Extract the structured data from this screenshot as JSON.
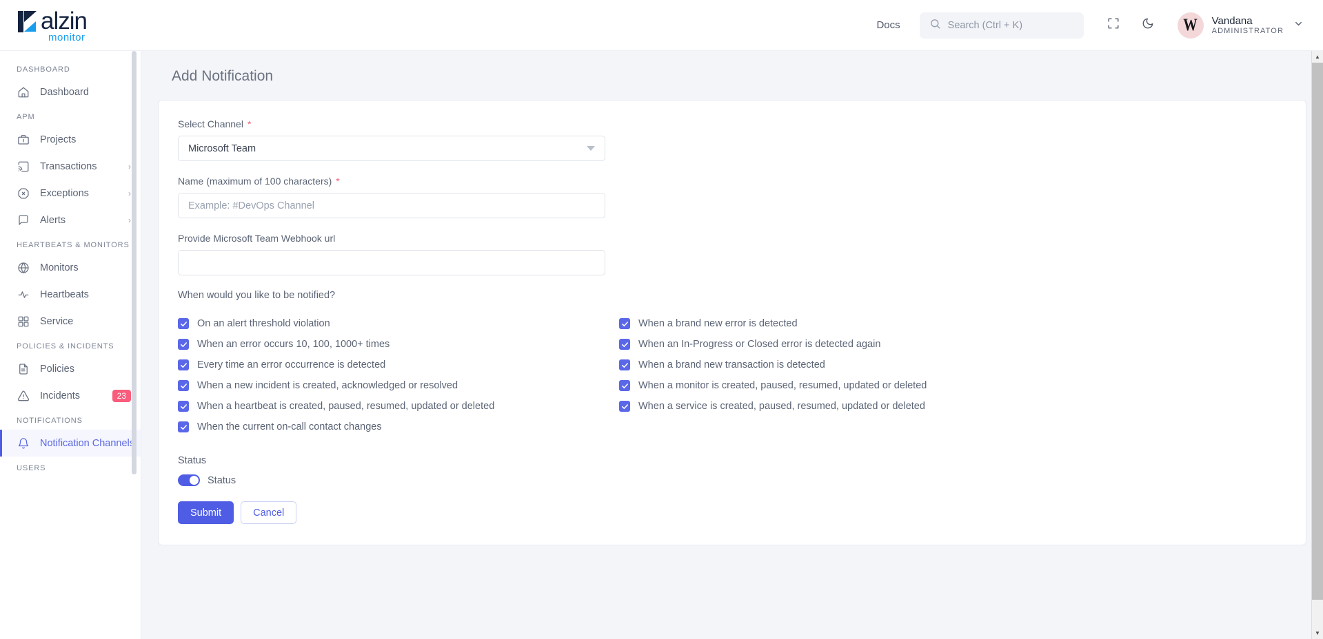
{
  "brand": {
    "name": "alzin",
    "sub": "monitor"
  },
  "header": {
    "docs_label": "Docs",
    "search_placeholder": "Search (Ctrl + K)",
    "fullscreen_icon": "fullscreen-icon",
    "theme_icon": "moon-icon",
    "profile": {
      "avatar_initial": "W",
      "name": "Vandana",
      "role": "ADMINISTRATOR"
    }
  },
  "sidebar": {
    "sections": [
      {
        "title": "DASHBOARD",
        "items": [
          {
            "label": "Dashboard",
            "icon": "home-icon",
            "chevron": false,
            "active": false,
            "badge": null
          }
        ]
      },
      {
        "title": "APM",
        "items": [
          {
            "label": "Projects",
            "icon": "briefcase-icon",
            "chevron": false,
            "active": false,
            "badge": null
          },
          {
            "label": "Transactions",
            "icon": "cast-icon",
            "chevron": true,
            "active": false,
            "badge": null
          },
          {
            "label": "Exceptions",
            "icon": "octagon-x-icon",
            "chevron": true,
            "active": false,
            "badge": null
          },
          {
            "label": "Alerts",
            "icon": "message-square-icon",
            "chevron": true,
            "active": false,
            "badge": null
          }
        ]
      },
      {
        "title": "HEARTBEATS & MONITORS",
        "items": [
          {
            "label": "Monitors",
            "icon": "globe-icon",
            "chevron": false,
            "active": false,
            "badge": null
          },
          {
            "label": "Heartbeats",
            "icon": "activity-icon",
            "chevron": false,
            "active": false,
            "badge": null
          },
          {
            "label": "Service",
            "icon": "grid-icon",
            "chevron": false,
            "active": false,
            "badge": null
          }
        ]
      },
      {
        "title": "POLICIES & INCIDENTS",
        "items": [
          {
            "label": "Policies",
            "icon": "file-text-icon",
            "chevron": false,
            "active": false,
            "badge": null
          },
          {
            "label": "Incidents",
            "icon": "alert-triangle-icon",
            "chevron": false,
            "active": false,
            "badge": "23"
          }
        ]
      },
      {
        "title": "NOTIFICATIONS",
        "items": [
          {
            "label": "Notification Channels",
            "icon": "bell-icon",
            "chevron": false,
            "active": true,
            "badge": null
          }
        ]
      },
      {
        "title": "USERS",
        "items": []
      }
    ]
  },
  "main": {
    "page_title": "Add Notification",
    "form": {
      "channel": {
        "label": "Select Channel",
        "required": true,
        "value": "Microsoft Team"
      },
      "name": {
        "label": "Name (maximum of 100 characters)",
        "required": true,
        "value": "",
        "placeholder": "Example: #DevOps Channel"
      },
      "webhook": {
        "label": "Provide Microsoft Team Webhook url",
        "required": false,
        "value": "",
        "placeholder": ""
      },
      "notify_question": "When would you like to be notified?",
      "checkboxes_left": [
        {
          "label": "On an alert threshold violation",
          "checked": true
        },
        {
          "label": "When an error occurs 10, 100, 1000+ times",
          "checked": true
        },
        {
          "label": "Every time an error occurrence is detected",
          "checked": true
        },
        {
          "label": "When a new incident is created, acknowledged or resolved",
          "checked": true
        },
        {
          "label": "When a heartbeat is created, paused, resumed, updated or deleted",
          "checked": true
        },
        {
          "label": "When the current on-call contact changes",
          "checked": true
        }
      ],
      "checkboxes_right": [
        {
          "label": "When a brand new error is detected",
          "checked": true
        },
        {
          "label": "When an In-Progress or Closed error is detected again",
          "checked": true
        },
        {
          "label": "When a brand new transaction is detected",
          "checked": true
        },
        {
          "label": "When a monitor is created, paused, resumed, updated or deleted",
          "checked": true
        },
        {
          "label": "When a service is created, paused, resumed, updated or deleted",
          "checked": true
        }
      ],
      "status_heading": "Status",
      "status_toggle_label": "Status",
      "status_toggle_on": true,
      "submit_label": "Submit",
      "cancel_label": "Cancel"
    }
  },
  "colors": {
    "accent": "#4f5de4",
    "checkbox": "#5a67e8",
    "badge": "#fa5c7c",
    "brand_dark": "#14233f",
    "brand_blue": "#1b9ded",
    "page_bg": "#f3f5f9"
  }
}
